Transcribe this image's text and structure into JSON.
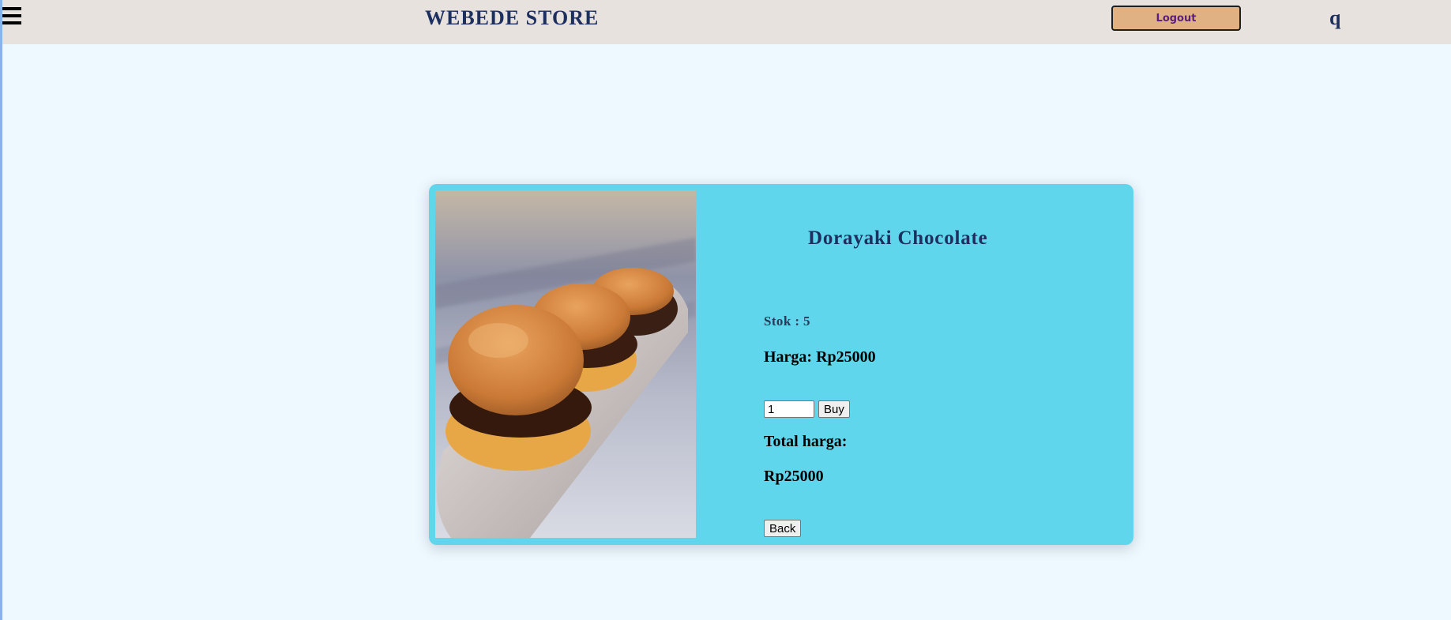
{
  "header": {
    "brand": "WEBEDE STORE",
    "logout_label": "Logout",
    "user_initial": "q"
  },
  "product": {
    "title": "Dorayaki Chocolate",
    "stock_text": "Stok : 5",
    "price_text": "Harga: Rp25000",
    "quantity_value": "1",
    "buy_label": "Buy",
    "total_label": "Total harga:",
    "total_value": "Rp25000",
    "back_label": "Back"
  },
  "colors": {
    "page_background": "#eef8ff",
    "navbar_background": "#e8e2de",
    "card_background": "#60d6ec",
    "title_color": "#1c2f5e",
    "logout_background": "#e0b283",
    "logout_text": "#5d1d7e"
  },
  "icons": {
    "menu": "hamburger-menu-icon"
  }
}
